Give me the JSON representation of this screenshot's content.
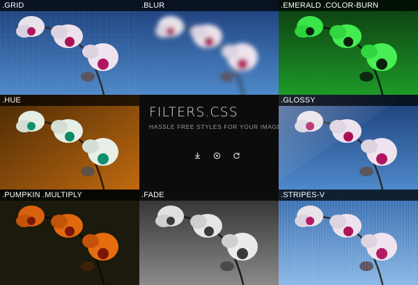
{
  "tiles": [
    {
      "label": ".GRID",
      "variant": "grid"
    },
    {
      "label": ".BLUR",
      "variant": "blur"
    },
    {
      "label": ".EMERALD .COLOR-BURN",
      "variant": "emerald"
    },
    {
      "label": ".HUE",
      "variant": "hue"
    },
    {
      "label": ".GLOSSY",
      "variant": "glossy"
    },
    {
      "label": ".PUMPKIN .MULTIPLY",
      "variant": "pumpkin"
    },
    {
      "label": ".FADE",
      "variant": "fade"
    },
    {
      "label": ".STRIPES-V",
      "variant": "stripes"
    }
  ],
  "center": {
    "title": "FILTERS.CSS",
    "subtitle": "HASSLE FREE STYLES FOR YOUR IMAGES",
    "icons": [
      "download-icon",
      "github-icon",
      "refresh-icon"
    ]
  },
  "colors": {
    "sky_top": "#1c3f7a",
    "sky_bottom": "#6fa6dd",
    "emerald": "#1fae2c",
    "hue_bg": "#b15a09",
    "pumpkin_bg": "#1a1a0a",
    "petal": "#e9dbe8",
    "lip": "#b3155f"
  }
}
